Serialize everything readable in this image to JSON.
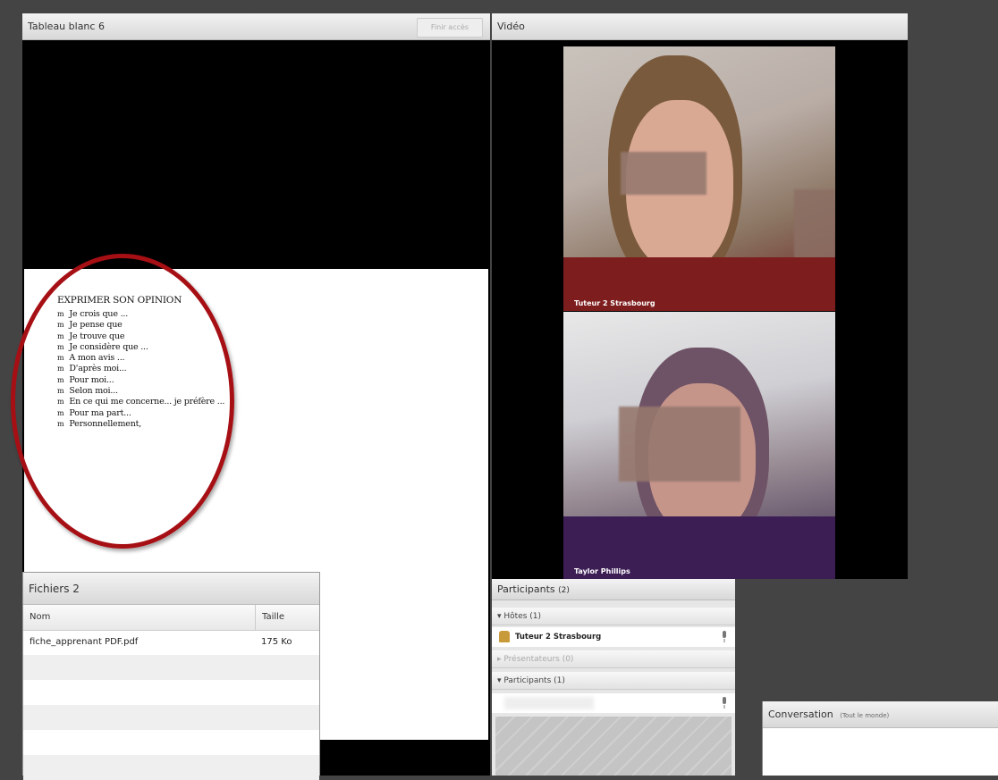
{
  "whiteboard": {
    "title": "Tableau blanc 6",
    "header_button": "Finir accès",
    "document": {
      "title": "EXPRIMER SON OPINION",
      "bullet": "m",
      "lines": [
        "Je crois que ...",
        "Je pense que",
        "Je trouve que",
        "Je considère que ...",
        "A mon avis ...",
        "D'après moi...",
        "Pour moi...",
        "Selon moi...",
        "En ce qui me concerne... je préfère ...",
        "Pour ma part...",
        "Personnellement,"
      ]
    },
    "highlight_color": "#a60f14"
  },
  "files": {
    "title": "Fichiers 2",
    "columns": [
      "Nom",
      "Taille"
    ],
    "rows": [
      {
        "name": "fiche_apprenant PDF.pdf",
        "size": "175 Ko"
      }
    ]
  },
  "video": {
    "title": "Vidéo",
    "feeds": [
      {
        "label": "Tuteur 2 Strasbourg"
      },
      {
        "label": "Taylor Phillips"
      }
    ]
  },
  "participants": {
    "title": "Participants",
    "count": "(2)",
    "sections": [
      {
        "label": "Hôtes (1)",
        "icon": "triangle-down-icon",
        "members": [
          "Tuteur 2 Strasbourg"
        ]
      },
      {
        "label": "Présentateurs (0)",
        "icon": "triangle-right-icon",
        "members": []
      },
      {
        "label": "Participants (1)",
        "icon": "triangle-down-icon",
        "members": [
          ""
        ]
      }
    ]
  },
  "conversation": {
    "title": "Conversation",
    "scope": "(Tout le monde)"
  }
}
